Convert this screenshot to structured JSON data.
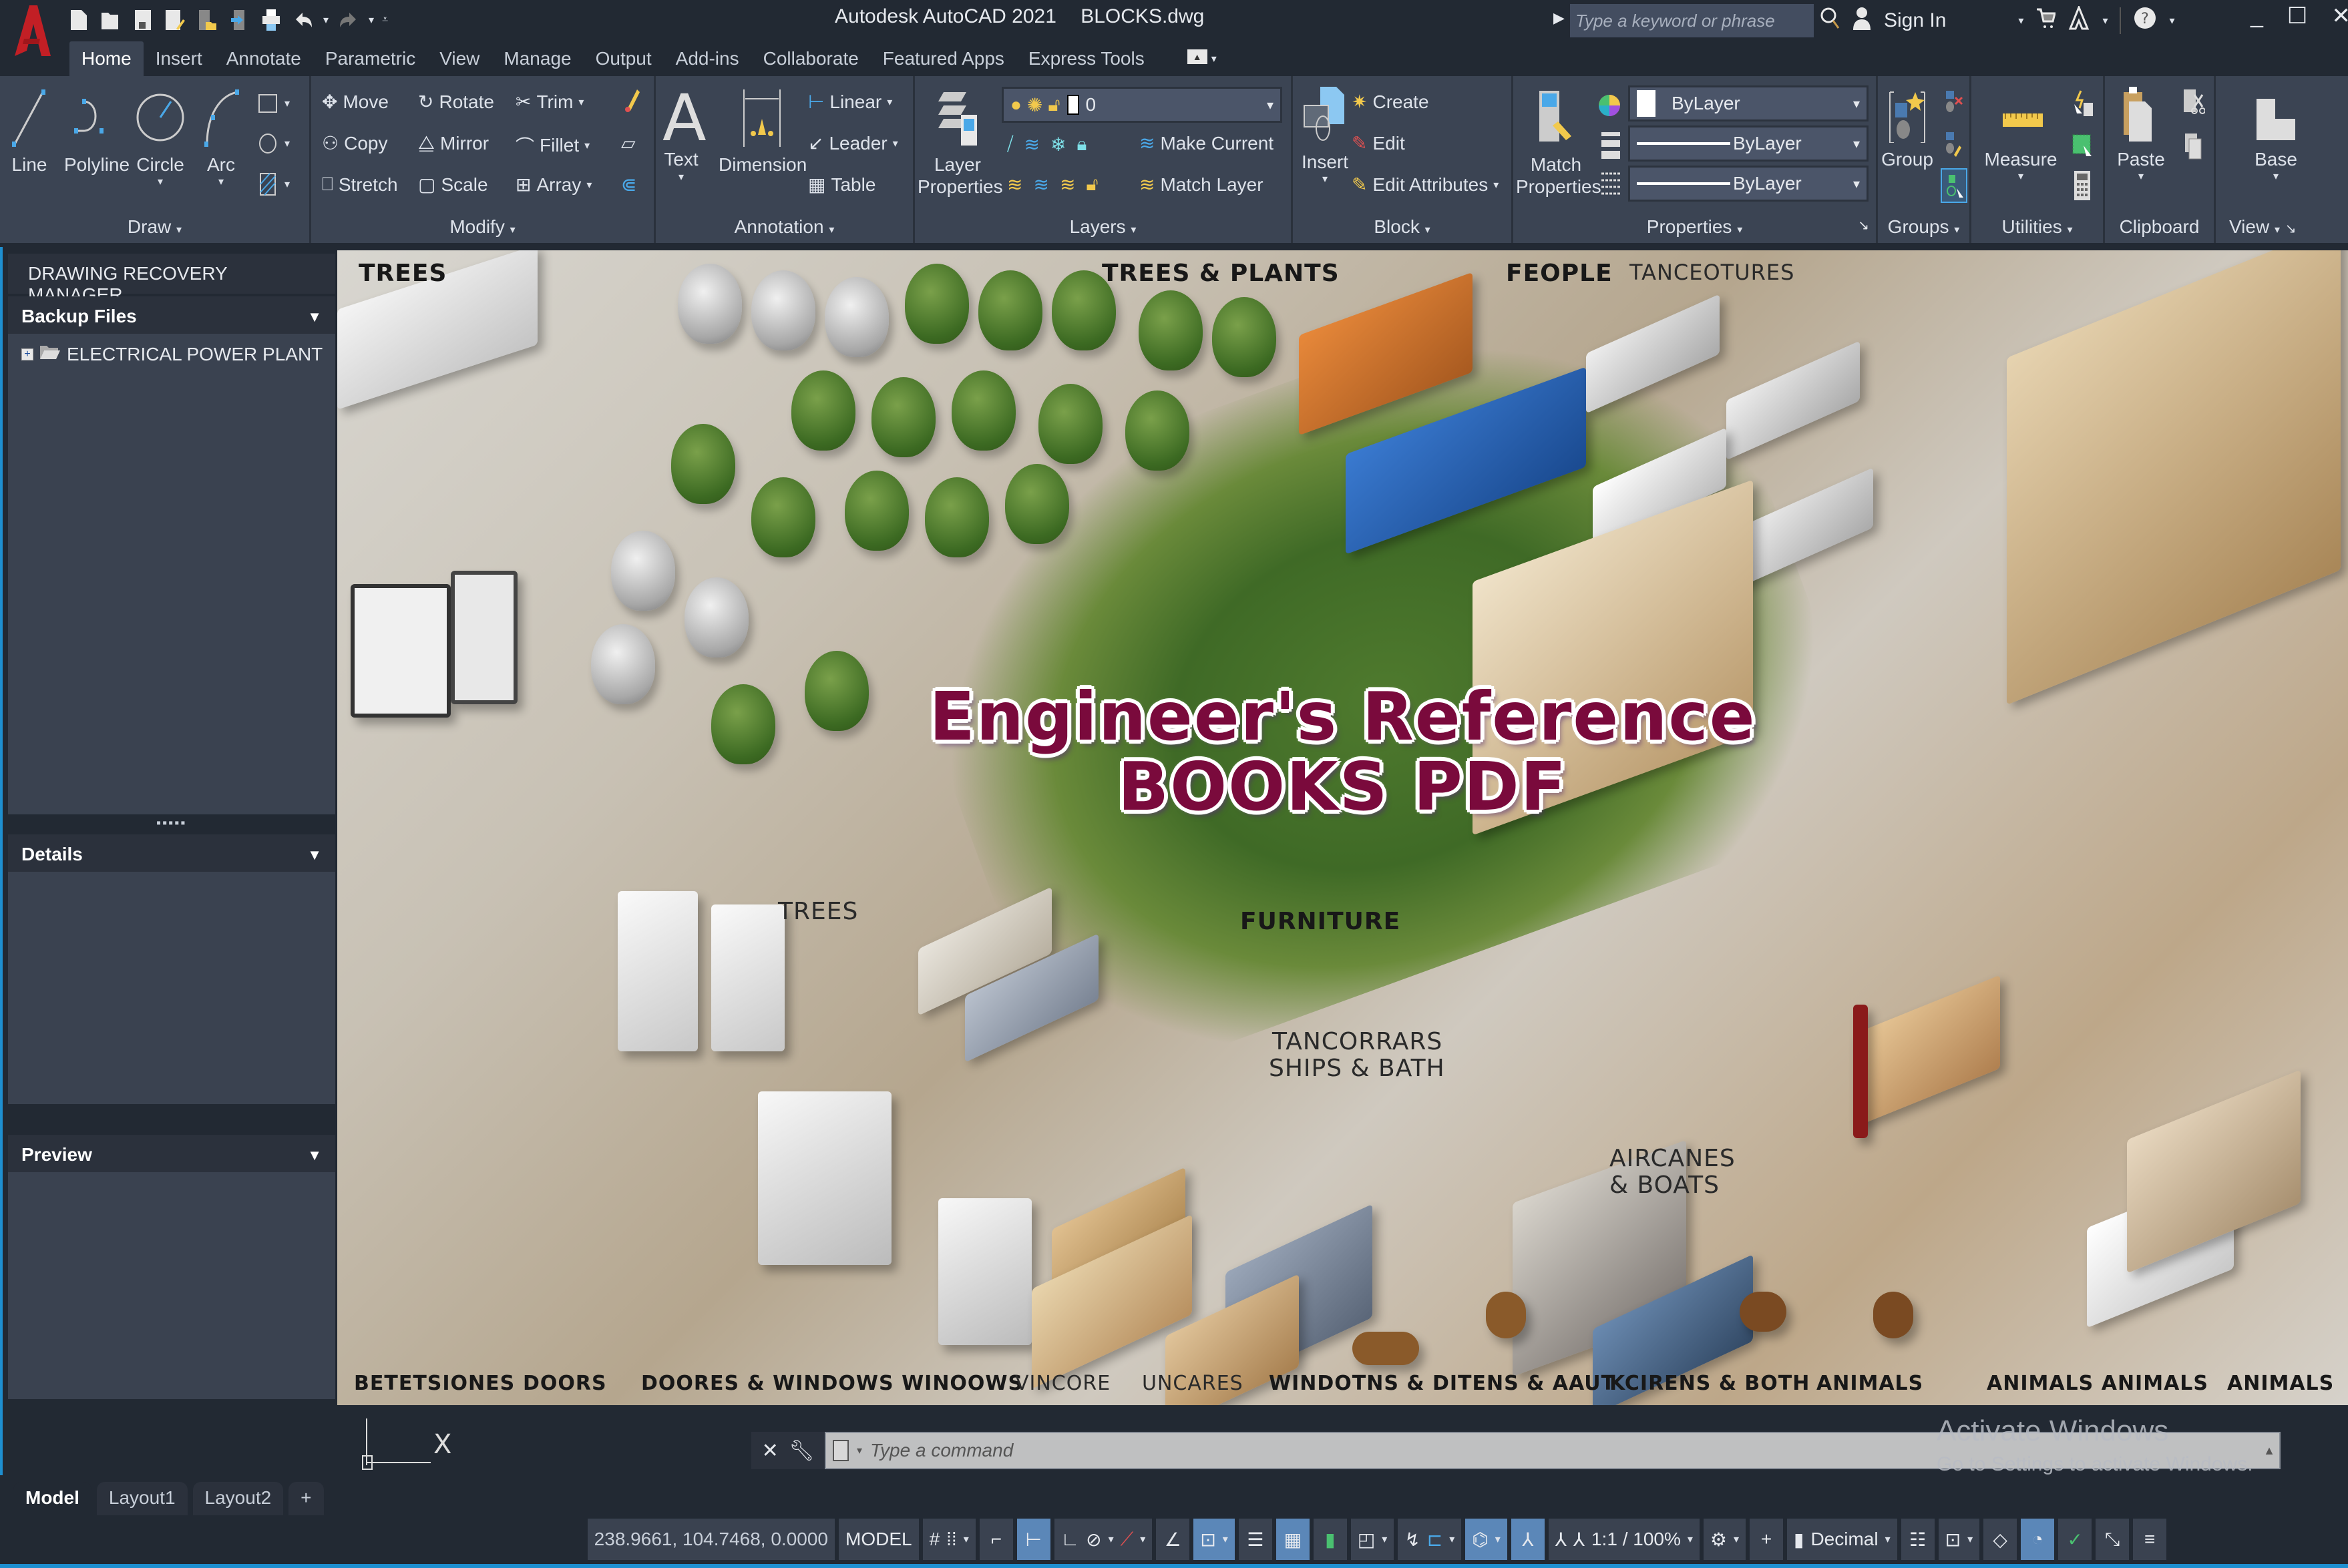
{
  "app": {
    "title": "Autodesk AutoCAD 2021",
    "filename": "BLOCKS.dwg",
    "search_placeholder": "Type a keyword or phrase",
    "sign_in": "Sign In"
  },
  "tabs": [
    {
      "label": "Home",
      "active": true
    },
    {
      "label": "Insert"
    },
    {
      "label": "Annotate"
    },
    {
      "label": "Parametric"
    },
    {
      "label": "View"
    },
    {
      "label": "Manage"
    },
    {
      "label": "Output"
    },
    {
      "label": "Add-ins"
    },
    {
      "label": "Collaborate"
    },
    {
      "label": "Featured Apps"
    },
    {
      "label": "Express Tools"
    }
  ],
  "ribbon": {
    "draw": {
      "label": "Draw",
      "line": "Line",
      "polyline": "Polyline",
      "circle": "Circle",
      "arc": "Arc"
    },
    "modify": {
      "label": "Modify",
      "move": "Move",
      "rotate": "Rotate",
      "trim": "Trim",
      "copy": "Copy",
      "mirror": "Mirror",
      "fillet": "Fillet",
      "stretch": "Stretch",
      "scale": "Scale",
      "array": "Array"
    },
    "annotation": {
      "label": "Annotation",
      "text": "Text",
      "dimension": "Dimension",
      "linear": "Linear",
      "leader": "Leader",
      "table": "Table"
    },
    "layers": {
      "label": "Layers",
      "layer_properties_1": "Layer",
      "layer_properties_2": "Properties",
      "current_layer": "0",
      "make_current": "Make Current",
      "match_layer": "Match Layer"
    },
    "block": {
      "label": "Block",
      "insert": "Insert",
      "create": "Create",
      "edit": "Edit",
      "edit_attributes": "Edit Attributes"
    },
    "properties": {
      "label": "Properties",
      "match_1": "Match",
      "match_2": "Properties",
      "color": "ByLayer",
      "linetype": "ByLayer",
      "lineweight": "ByLayer"
    },
    "groups": {
      "label": "Groups",
      "group": "Group"
    },
    "utilities": {
      "label": "Utilities",
      "measure": "Measure"
    },
    "clipboard": {
      "label": "Clipboard",
      "paste": "Paste"
    },
    "view": {
      "label": "View",
      "base": "Base"
    }
  },
  "left_panel": {
    "title": "DRAWING RECOVERY MANAGER",
    "backup_files": "Backup Files",
    "tree_item": "ELECTRICAL POWER PLANT",
    "details": "Details",
    "preview": "Preview"
  },
  "canvas": {
    "headline_1": "Engineer's Reference",
    "headline_2": "BOOKS PDF",
    "labels_top": [
      "TREES",
      "TREES & PLANTS",
      "FEOPLE",
      "TANCEOTURES"
    ],
    "labels_mid": [
      "TREES",
      "FURNITURE",
      "TANCORRARS",
      "SHIPS & BATH",
      "AIRCANES",
      "& BOATS"
    ],
    "labels_bottom": [
      "BETETSIONES",
      "DOORS",
      "DOORES & WINDOWS WINOOWS",
      "VINCORE",
      "UNCARES",
      "WINDOTNS & DITENS & AAUT",
      "KCIRENS & BOTH",
      "ANIMALS",
      "ANIMALS ANIMALS",
      "ANIMALS"
    ]
  },
  "command": {
    "placeholder": "Type a command",
    "ucs_x": "X"
  },
  "watermark": {
    "line1": "Activate Windows",
    "line2": "Go to Settings to activate Windows."
  },
  "layout_tabs": [
    {
      "label": "Model",
      "active": true
    },
    {
      "label": "Layout1"
    },
    {
      "label": "Layout2"
    },
    {
      "label": "+"
    }
  ],
  "status": {
    "coords": "238.9661, 104.7468, 0.0000",
    "space": "MODEL",
    "scale": "1:1 / 100%",
    "units": "Decimal"
  },
  "colors": {
    "accent": "#1e8fd0",
    "ribbon_bg": "#3b4453",
    "title_bg": "#222933",
    "headline": "#7a0a3c",
    "status_on": "#5b87b8"
  }
}
